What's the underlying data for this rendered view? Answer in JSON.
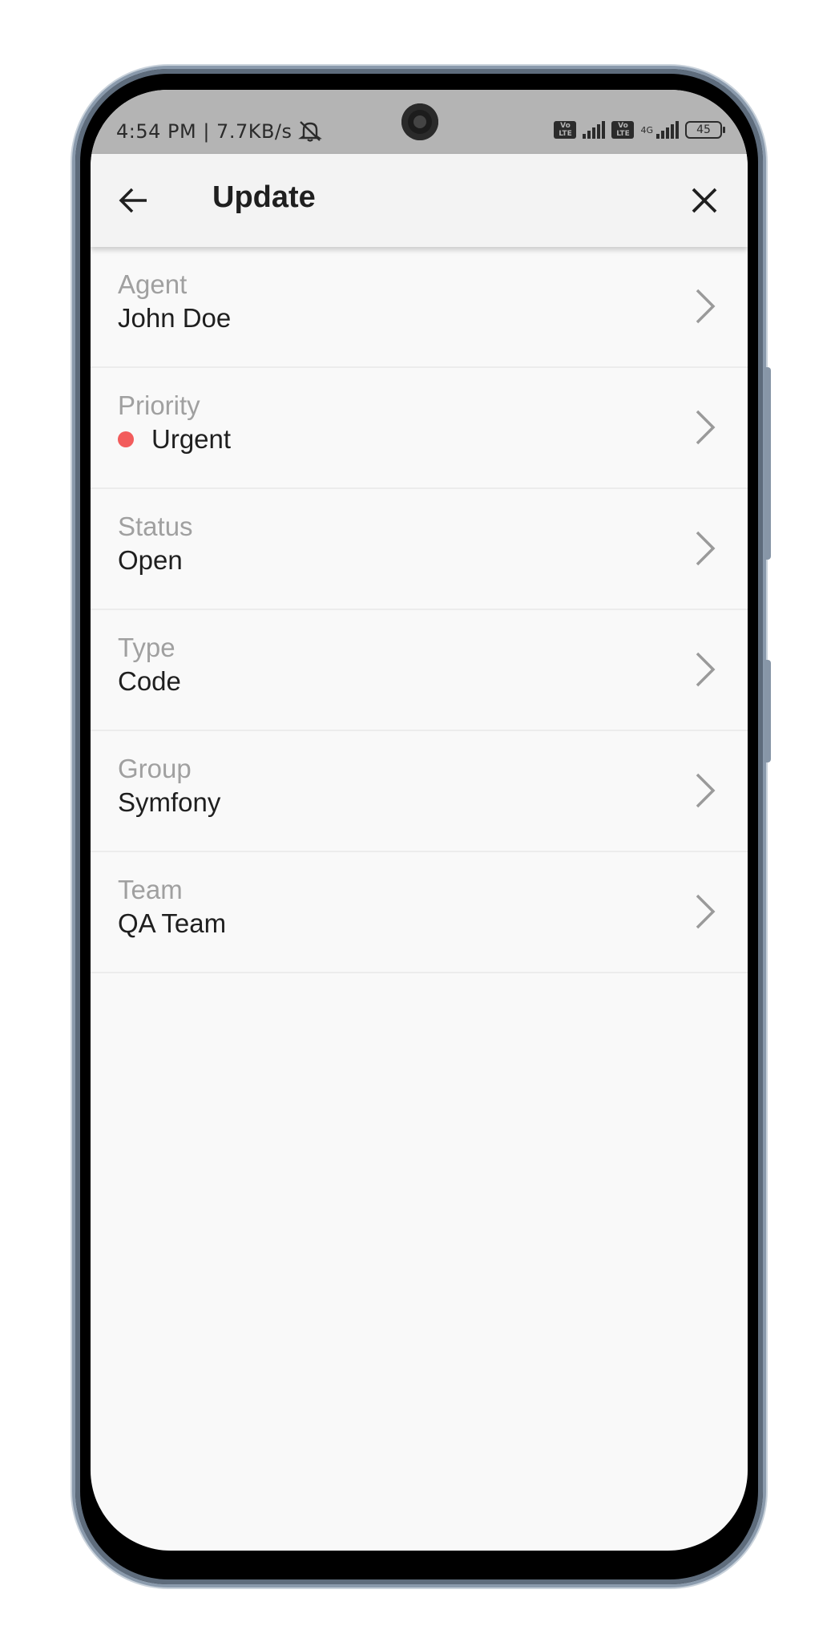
{
  "status_bar": {
    "time": "4:54 PM | 7.7KB/s",
    "volte_label": "Vo LTE",
    "network": "4G",
    "battery": "45"
  },
  "header": {
    "title": "Update"
  },
  "fields": [
    {
      "label": "Agent",
      "value": "John Doe"
    },
    {
      "label": "Priority",
      "value": "Urgent",
      "indicator_color": "#f25c5c"
    },
    {
      "label": "Status",
      "value": "Open"
    },
    {
      "label": "Type",
      "value": "Code"
    },
    {
      "label": "Group",
      "value": "Symfony"
    },
    {
      "label": "Team",
      "value": "QA Team"
    }
  ]
}
